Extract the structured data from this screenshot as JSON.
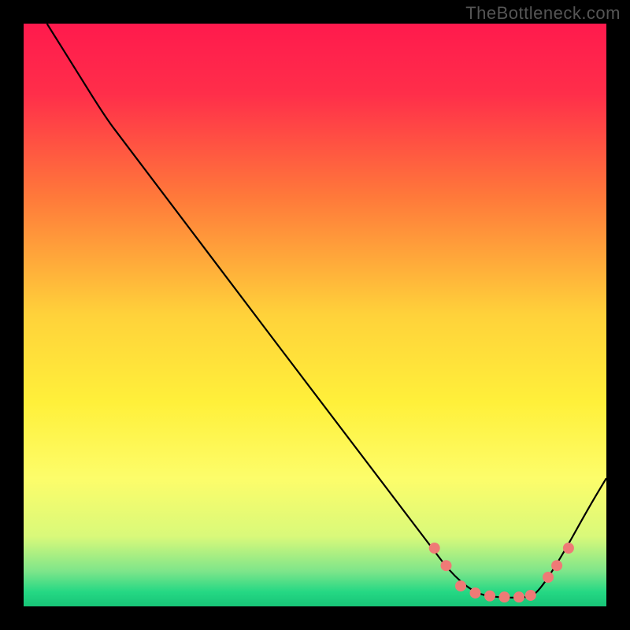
{
  "watermark": "TheBottleneck.com",
  "chart_data": {
    "type": "line",
    "title": "",
    "xlabel": "",
    "ylabel": "",
    "xlim": [
      0,
      100
    ],
    "ylim": [
      0,
      100
    ],
    "background_gradient": {
      "stops": [
        {
          "offset": 0.0,
          "color": "#ff1a4d"
        },
        {
          "offset": 0.12,
          "color": "#ff2e4a"
        },
        {
          "offset": 0.3,
          "color": "#ff7a3a"
        },
        {
          "offset": 0.5,
          "color": "#ffd23a"
        },
        {
          "offset": 0.65,
          "color": "#fff03a"
        },
        {
          "offset": 0.78,
          "color": "#fdfd6a"
        },
        {
          "offset": 0.88,
          "color": "#d9f97a"
        },
        {
          "offset": 0.94,
          "color": "#7de58a"
        },
        {
          "offset": 0.975,
          "color": "#25d884"
        },
        {
          "offset": 1.0,
          "color": "#17c477"
        }
      ]
    },
    "curve": {
      "comment": "Bottleneck curve: high at left, descends roughly linearly, dips to a flat minimum near x≈78–88, then rises again toward right edge.",
      "points": [
        {
          "x": 4,
          "y": 100
        },
        {
          "x": 9,
          "y": 92
        },
        {
          "x": 14,
          "y": 84
        },
        {
          "x": 17,
          "y": 80
        },
        {
          "x": 70,
          "y": 10
        },
        {
          "x": 74,
          "y": 5
        },
        {
          "x": 78,
          "y": 2.0
        },
        {
          "x": 82,
          "y": 1.5
        },
        {
          "x": 86,
          "y": 1.5
        },
        {
          "x": 88,
          "y": 2.0
        },
        {
          "x": 92,
          "y": 8
        },
        {
          "x": 97,
          "y": 17
        },
        {
          "x": 100,
          "y": 22
        }
      ]
    },
    "markers": {
      "color": "#ef7a76",
      "radius": 7,
      "points": [
        {
          "x": 70.5,
          "y": 10
        },
        {
          "x": 72.5,
          "y": 7
        },
        {
          "x": 75,
          "y": 3.5
        },
        {
          "x": 77.5,
          "y": 2.3
        },
        {
          "x": 80,
          "y": 1.8
        },
        {
          "x": 82.5,
          "y": 1.6
        },
        {
          "x": 85,
          "y": 1.6
        },
        {
          "x": 87,
          "y": 1.9
        },
        {
          "x": 90,
          "y": 5
        },
        {
          "x": 91.5,
          "y": 7
        },
        {
          "x": 93.5,
          "y": 10
        }
      ]
    }
  }
}
